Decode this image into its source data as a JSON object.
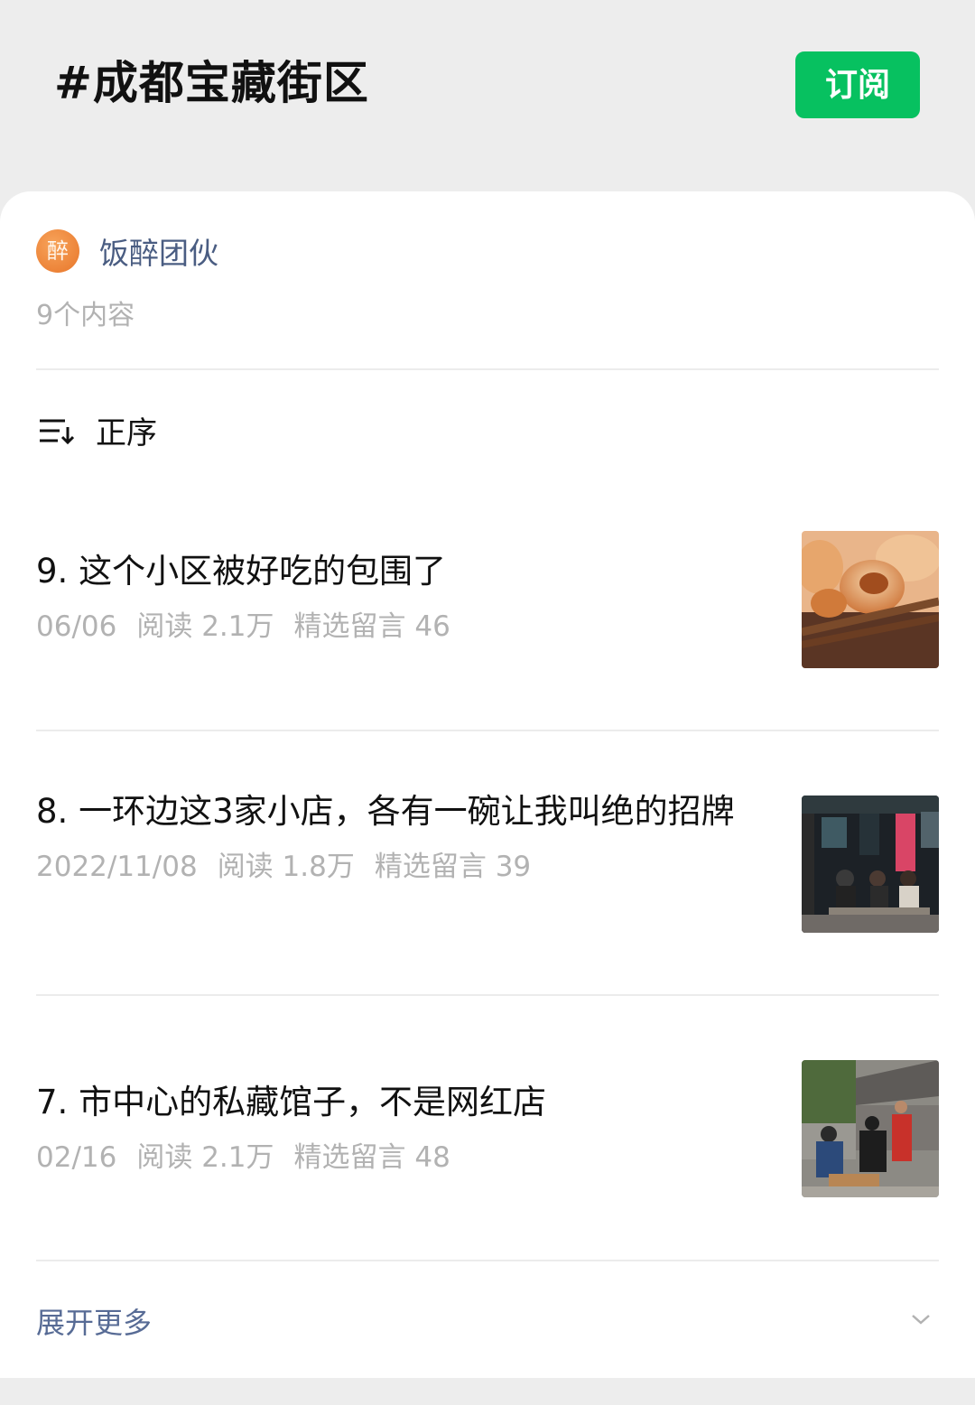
{
  "header": {
    "title": "#成都宝藏街区",
    "subscribe_label": "订阅"
  },
  "author": {
    "avatar_char": "醉",
    "name": "饭醉团伙",
    "content_count": "9个内容"
  },
  "sort": {
    "icon": "sort-order-icon",
    "label": "正序"
  },
  "articles": [
    {
      "title": "9. 这个小区被好吃的包围了",
      "date": "06/06",
      "reads": "阅读 2.1万",
      "comments": "精选留言 46",
      "thumbnail": "fried-dumplings-with-chopsticks"
    },
    {
      "title": "8. 一环边这3家小店，各有一碗让我叫绝的招牌",
      "date": "2022/11/08",
      "reads": "阅读 1.8万",
      "comments": "精选留言 39",
      "thumbnail": "street-diners-at-night"
    },
    {
      "title": "7. 市中心的私藏馆子，不是网红店",
      "date": "02/16",
      "reads": "阅读 2.1万",
      "comments": "精选留言 48",
      "thumbnail": "outdoor-street-restaurant"
    }
  ],
  "expand": {
    "label": "展开更多",
    "icon": "chevron-down-icon"
  },
  "colors": {
    "accent_green": "#07c160",
    "link_blue": "#576b95",
    "meta_gray": "#b2b2b2",
    "background": "#ededed"
  }
}
